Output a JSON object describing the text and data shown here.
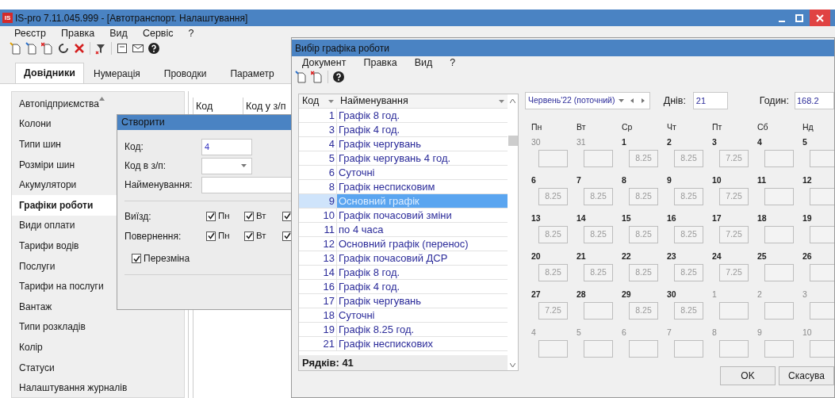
{
  "main_window": {
    "logo": "IS",
    "title": "IS-pro 7.11.045.999 - [Автотранспорт. Налаштування]"
  },
  "menu": [
    "Реєстр",
    "Правка",
    "Вид",
    "Сервіс",
    "?"
  ],
  "tabs": [
    {
      "label": "Довідники",
      "selected": true
    },
    {
      "label": "Нумерація",
      "selected": false
    },
    {
      "label": "Проводки",
      "selected": false
    },
    {
      "label": "Параметр",
      "selected": false
    }
  ],
  "sidebar": {
    "items": [
      {
        "label": "Автопідприємства",
        "selected": false
      },
      {
        "label": "Колони",
        "selected": false
      },
      {
        "label": "Типи шин",
        "selected": false
      },
      {
        "label": "Розміри шин",
        "selected": false
      },
      {
        "label": "Акумулятори",
        "selected": false
      },
      {
        "label": "Графіки роботи",
        "selected": true
      },
      {
        "label": "Види оплати",
        "selected": false
      },
      {
        "label": "Тарифи водів",
        "selected": false
      },
      {
        "label": "Послуги",
        "selected": false
      },
      {
        "label": "Тарифи на послуги",
        "selected": false
      },
      {
        "label": "Вантаж",
        "selected": false
      },
      {
        "label": "Типи розкладів",
        "selected": false
      },
      {
        "label": "Колір",
        "selected": false
      },
      {
        "label": "Статуси",
        "selected": false
      },
      {
        "label": "Налаштування журналів",
        "selected": false
      }
    ]
  },
  "grid": {
    "columns": [
      "Код",
      "Код у з/п"
    ]
  },
  "create_dialog": {
    "title": "Створити",
    "code_label": "Код:",
    "code_value": "4",
    "payroll_label": "Код в з/п:",
    "name_label": "Найменування:",
    "day_rows": [
      {
        "label": "Виїзд:",
        "days": [
          {
            "label": "Пн",
            "checked": true
          },
          {
            "label": "Вт",
            "checked": true
          },
          {
            "checked": true
          }
        ]
      },
      {
        "label": "Повернення:",
        "days": [
          {
            "label": "Пн",
            "checked": true
          },
          {
            "label": "Вт",
            "checked": true
          },
          {
            "checked": true
          }
        ]
      }
    ],
    "shift": {
      "label": "Перезміна",
      "checked": true
    }
  },
  "select_dialog": {
    "title": "Вибір графіка роботи",
    "menu": [
      "Документ",
      "Правка",
      "Вид",
      "?"
    ],
    "table": {
      "columns": [
        "Код",
        "Найменування"
      ],
      "rows": [
        {
          "code": "1",
          "name": "Графік 8 год.",
          "selected": false
        },
        {
          "code": "3",
          "name": "Графік 4 год.",
          "selected": false
        },
        {
          "code": "4",
          "name": "Графік чергувань",
          "selected": false
        },
        {
          "code": "5",
          "name": "Графік чергувань 4 год.",
          "selected": false
        },
        {
          "code": "6",
          "name": "Суточні",
          "selected": false
        },
        {
          "code": "8",
          "name": "Графік несписковим",
          "selected": false
        },
        {
          "code": "9",
          "name": "Основний графік",
          "selected": true
        },
        {
          "code": "10",
          "name": "Графік почасовий зміни",
          "selected": false
        },
        {
          "code": "11",
          "name": "по 4 часа",
          "selected": false
        },
        {
          "code": "12",
          "name": "Основний графік (перенос)",
          "selected": false
        },
        {
          "code": "13",
          "name": "Графік почасовий ДСР",
          "selected": false
        },
        {
          "code": "14",
          "name": "Графік 8 год.",
          "selected": false
        },
        {
          "code": "16",
          "name": "Графік 4 год.",
          "selected": false
        },
        {
          "code": "17",
          "name": "Графік чергувань",
          "selected": false
        },
        {
          "code": "18",
          "name": "Суточні",
          "selected": false
        },
        {
          "code": "19",
          "name": "Графік 8.25 год.",
          "selected": false
        },
        {
          "code": "21",
          "name": "Графік неспискових",
          "selected": false
        }
      ],
      "footer": "Рядків: 41"
    },
    "month": "Червень'22 (поточний)",
    "days_label": "Днів:",
    "days_value": "21",
    "hours_label": "Годин:",
    "hours_value": "168.2",
    "weekdays": [
      "Пн",
      "Вт",
      "Ср",
      "Чт",
      "Пт",
      "Сб",
      "Нд"
    ],
    "weeks": [
      [
        {
          "day": "30",
          "outside": true
        },
        {
          "day": "31",
          "outside": true
        },
        {
          "day": "1",
          "outside": false,
          "hours": "8.25"
        },
        {
          "day": "2",
          "outside": false,
          "hours": "8.25"
        },
        {
          "day": "3",
          "outside": false,
          "hours": "7.25"
        },
        {
          "day": "4",
          "outside": false
        },
        {
          "day": "5",
          "outside": false
        }
      ],
      [
        {
          "day": "6",
          "outside": false,
          "hours": "8.25"
        },
        {
          "day": "7",
          "outside": false,
          "hours": "8.25"
        },
        {
          "day": "8",
          "outside": false,
          "hours": "8.25"
        },
        {
          "day": "9",
          "outside": false,
          "hours": "8.25"
        },
        {
          "day": "10",
          "outside": false,
          "hours": "7.25"
        },
        {
          "day": "11",
          "outside": false
        },
        {
          "day": "12",
          "outside": false
        }
      ],
      [
        {
          "day": "13",
          "outside": false,
          "hours": "8.25"
        },
        {
          "day": "14",
          "outside": false,
          "hours": "8.25"
        },
        {
          "day": "15",
          "outside": false,
          "hours": "8.25"
        },
        {
          "day": "16",
          "outside": false,
          "hours": "8.25"
        },
        {
          "day": "17",
          "outside": false,
          "hours": "7.25"
        },
        {
          "day": "18",
          "outside": false
        },
        {
          "day": "19",
          "outside": false
        }
      ],
      [
        {
          "day": "20",
          "outside": false,
          "hours": "8.25"
        },
        {
          "day": "21",
          "outside": false,
          "hours": "8.25"
        },
        {
          "day": "22",
          "outside": false,
          "hours": "8.25"
        },
        {
          "day": "23",
          "outside": false,
          "hours": "8.25"
        },
        {
          "day": "24",
          "outside": false,
          "hours": "7.25"
        },
        {
          "day": "25",
          "outside": false
        },
        {
          "day": "26",
          "outside": false
        }
      ],
      [
        {
          "day": "27",
          "outside": false,
          "hours": "7.25"
        },
        {
          "day": "28",
          "outside": false
        },
        {
          "day": "29",
          "outside": false,
          "hours": "8.25"
        },
        {
          "day": "30",
          "outside": false,
          "hours": "8.25"
        },
        {
          "day": "1",
          "outside": true
        },
        {
          "day": "2",
          "outside": true
        },
        {
          "day": "3",
          "outside": true
        }
      ],
      [
        {
          "day": "4",
          "outside": true
        },
        {
          "day": "5",
          "outside": true
        },
        {
          "day": "6",
          "outside": true
        },
        {
          "day": "7",
          "outside": true
        },
        {
          "day": "8",
          "outside": true
        },
        {
          "day": "9",
          "outside": true
        },
        {
          "day": "10",
          "outside": true
        }
      ]
    ],
    "buttons": [
      "OK",
      "Скасува"
    ]
  }
}
